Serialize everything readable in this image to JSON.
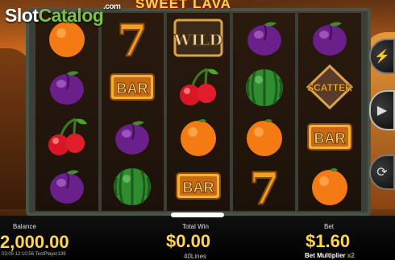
{
  "logo": {
    "slot": "Slot",
    "catalog": "Catalog",
    "com": ".com"
  },
  "game_title": "SWEET LAVA",
  "reels": [
    [
      "orange",
      "plum",
      "cherry",
      "plum"
    ],
    [
      "seven",
      "bar",
      "plum",
      "watermelon"
    ],
    [
      "wild",
      "cherry",
      "orange",
      "bar"
    ],
    [
      "plum",
      "watermelon",
      "orange",
      "seven"
    ],
    [
      "plum",
      "scatter",
      "bar",
      "orange"
    ]
  ],
  "symbol_labels": {
    "wild": "WILD",
    "bar": "BAR",
    "scatter": "SCATTER",
    "seven": "7"
  },
  "controls": {
    "lightning_icon": "lightning-icon",
    "spin_icon": "play-icon",
    "auto_icon": "autoplay-icon"
  },
  "footer": {
    "balance_label": "Balance",
    "balance_value": "2,000.00",
    "total_win_label": "Total Win",
    "total_win_value": "$0.00",
    "bet_label": "Bet",
    "bet_value": "$1.60",
    "lines": "40Lines",
    "bet_multiplier_label": "Bet Multiplier",
    "bet_multiplier_value": "x2",
    "timestamp_player": "03:05 12:10:56 TestPlayer139"
  },
  "colors": {
    "accent_gold": "#ffd64a",
    "logo_green": "#7bc142"
  }
}
